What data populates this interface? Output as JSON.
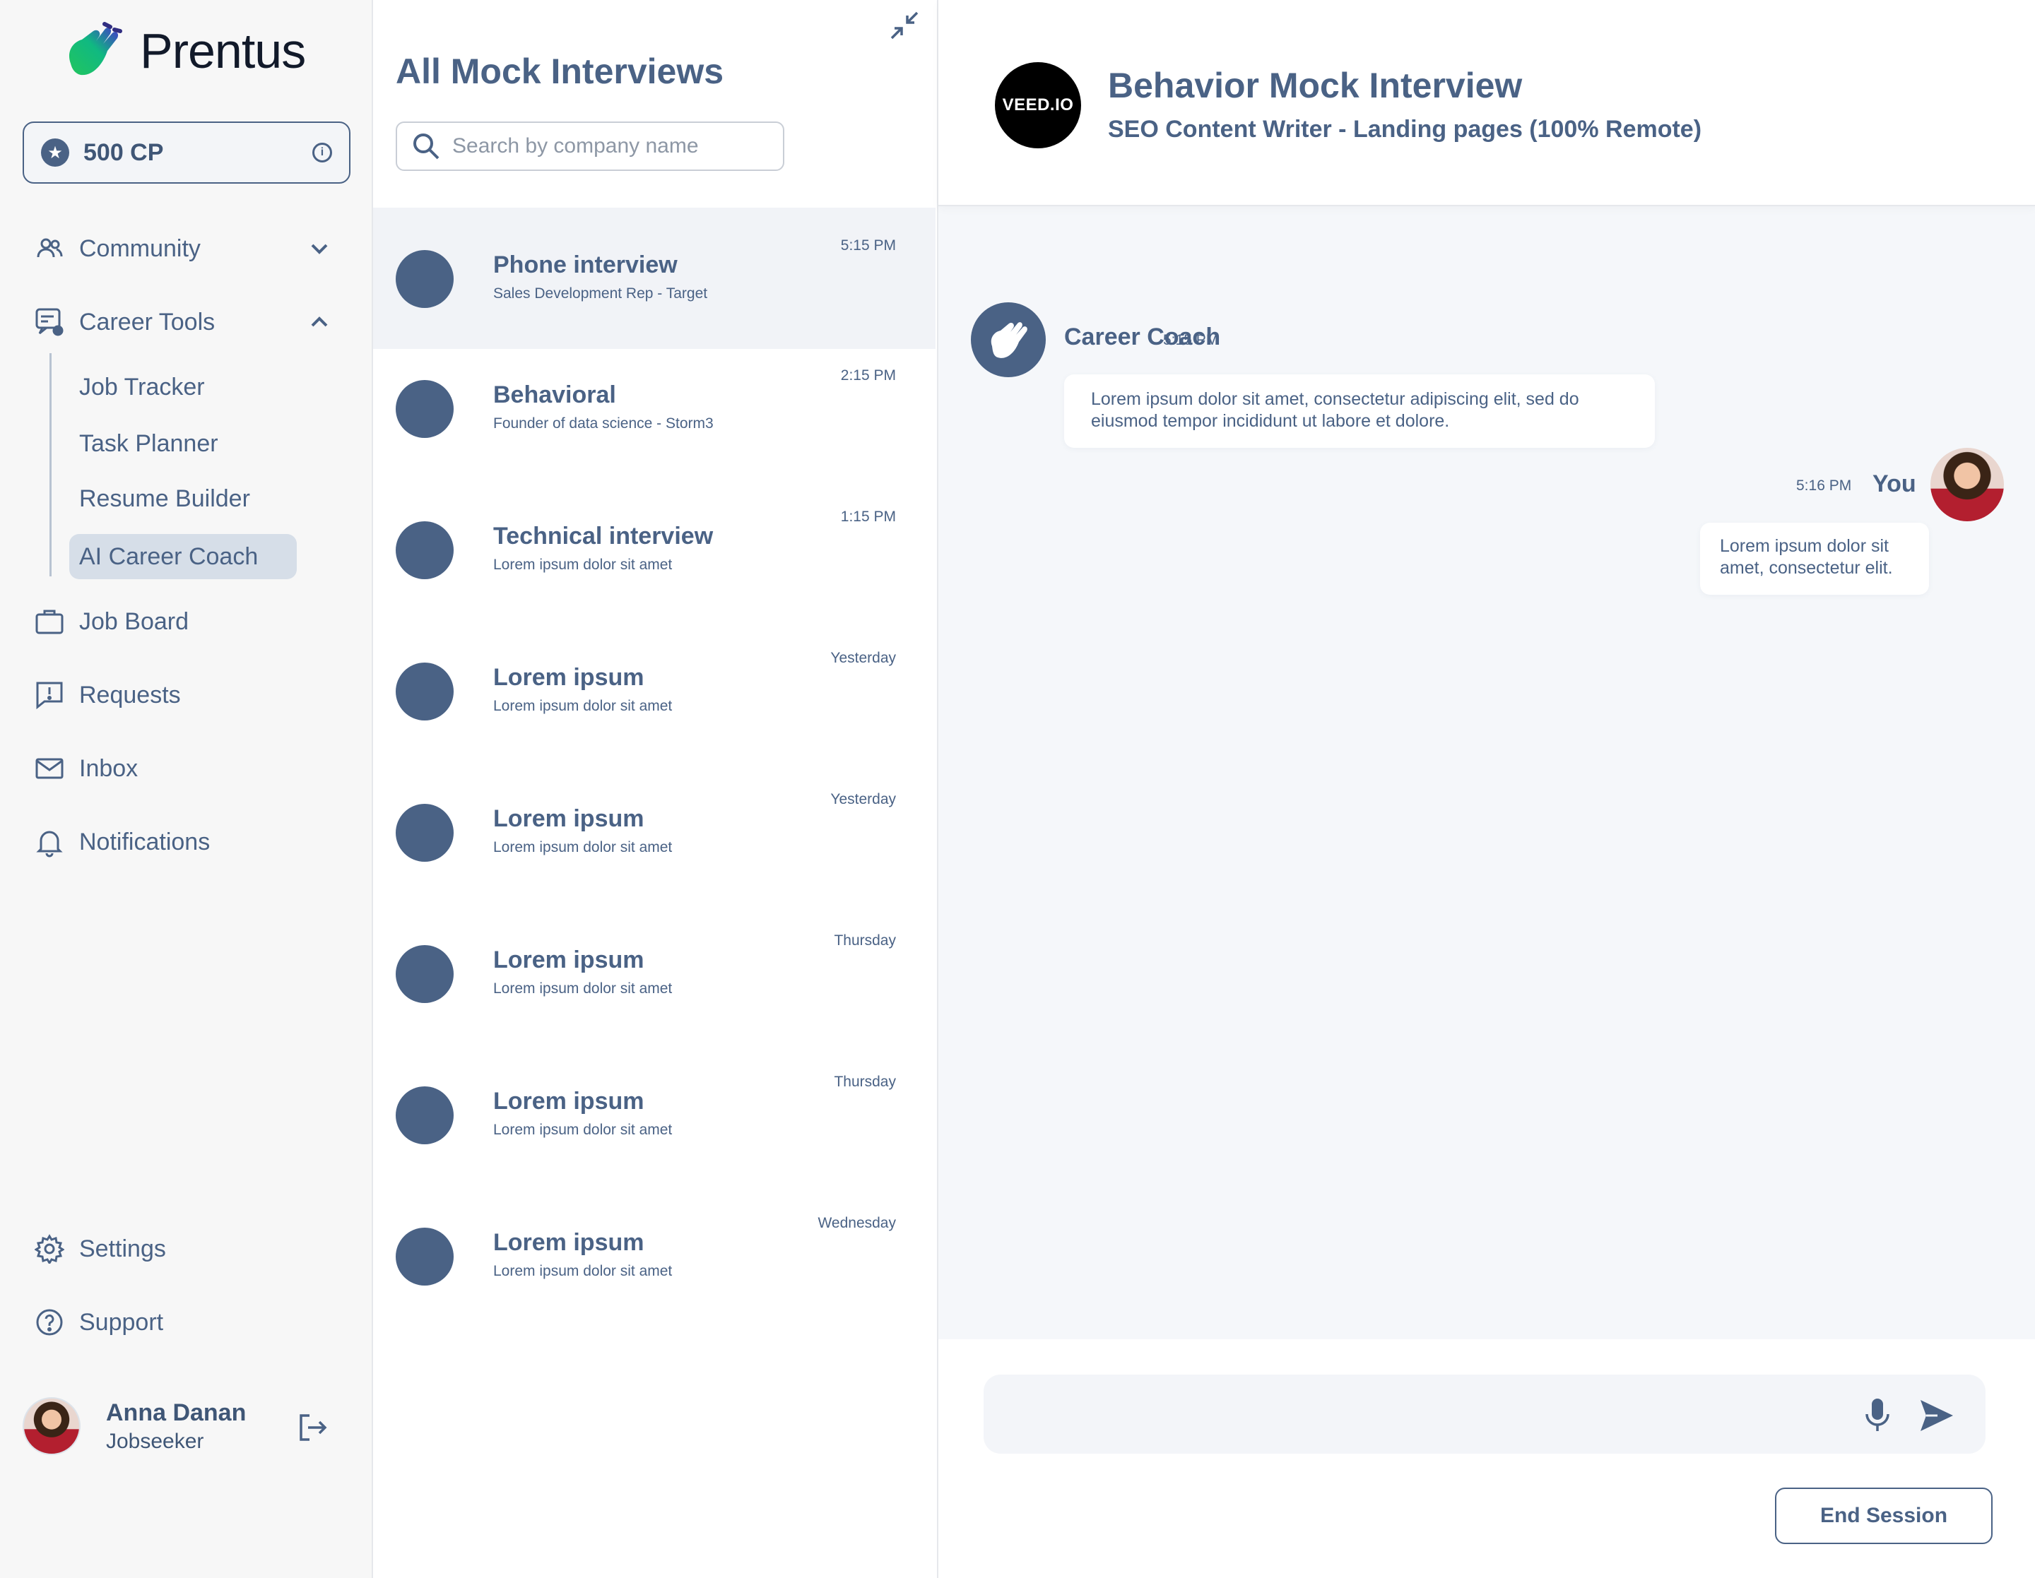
{
  "brand": {
    "name": "Prentus"
  },
  "credits": {
    "label": "500 CP"
  },
  "nav": {
    "community": "Community",
    "career_tools": "Career Tools",
    "sub_items": [
      "Job Tracker",
      "Task Planner",
      "Resume Builder",
      "AI Career Coach"
    ],
    "job_board": "Job Board",
    "requests": "Requests",
    "inbox": "Inbox",
    "notifications": "Notifications",
    "settings": "Settings",
    "support": "Support"
  },
  "user": {
    "name": "Anna Danan",
    "role": "Jobseeker"
  },
  "interviews": {
    "title": "All Mock Interviews",
    "search_placeholder": "Search by company name",
    "items": [
      {
        "title": "Phone interview",
        "subtitle": "Sales Development Rep - Target",
        "time": "5:15 PM"
      },
      {
        "title": "Behavioral",
        "subtitle": "Founder of data science - Storm3",
        "time": "2:15 PM"
      },
      {
        "title": "Technical interview",
        "subtitle": "Lorem ipsum dolor sit amet",
        "time": "1:15 PM"
      },
      {
        "title": "Lorem ipsum",
        "subtitle": "Lorem ipsum dolor sit amet",
        "time": "Yesterday"
      },
      {
        "title": "Lorem ipsum",
        "subtitle": "Lorem ipsum dolor sit amet",
        "time": "Yesterday"
      },
      {
        "title": "Lorem ipsum",
        "subtitle": "Lorem ipsum dolor sit amet",
        "time": "Thursday"
      },
      {
        "title": "Lorem ipsum",
        "subtitle": "Lorem ipsum dolor sit amet",
        "time": "Thursday"
      },
      {
        "title": "Lorem ipsum",
        "subtitle": "Lorem ipsum dolor sit amet",
        "time": "Wednesday"
      }
    ]
  },
  "chat": {
    "company_logo_text": "VEED.IO",
    "title": "Behavior Mock Interview",
    "subtitle": "SEO Content Writer - Landing pages (100% Remote)",
    "messages": [
      {
        "sender": "Career Coach",
        "time": "5:15 PM",
        "text": "Lorem ipsum dolor sit amet, consectetur adipiscing elit, sed do eiusmod tempor incididunt ut labore et dolore."
      },
      {
        "sender": "You",
        "time": "5:16 PM",
        "text": "Lorem ipsum dolor sit amet, consectetur  elit."
      }
    ],
    "end_session": "End Session"
  },
  "colors": {
    "primary": "#4a6285",
    "logo_green": "#22c55e",
    "logo_purple": "#4338ca"
  }
}
